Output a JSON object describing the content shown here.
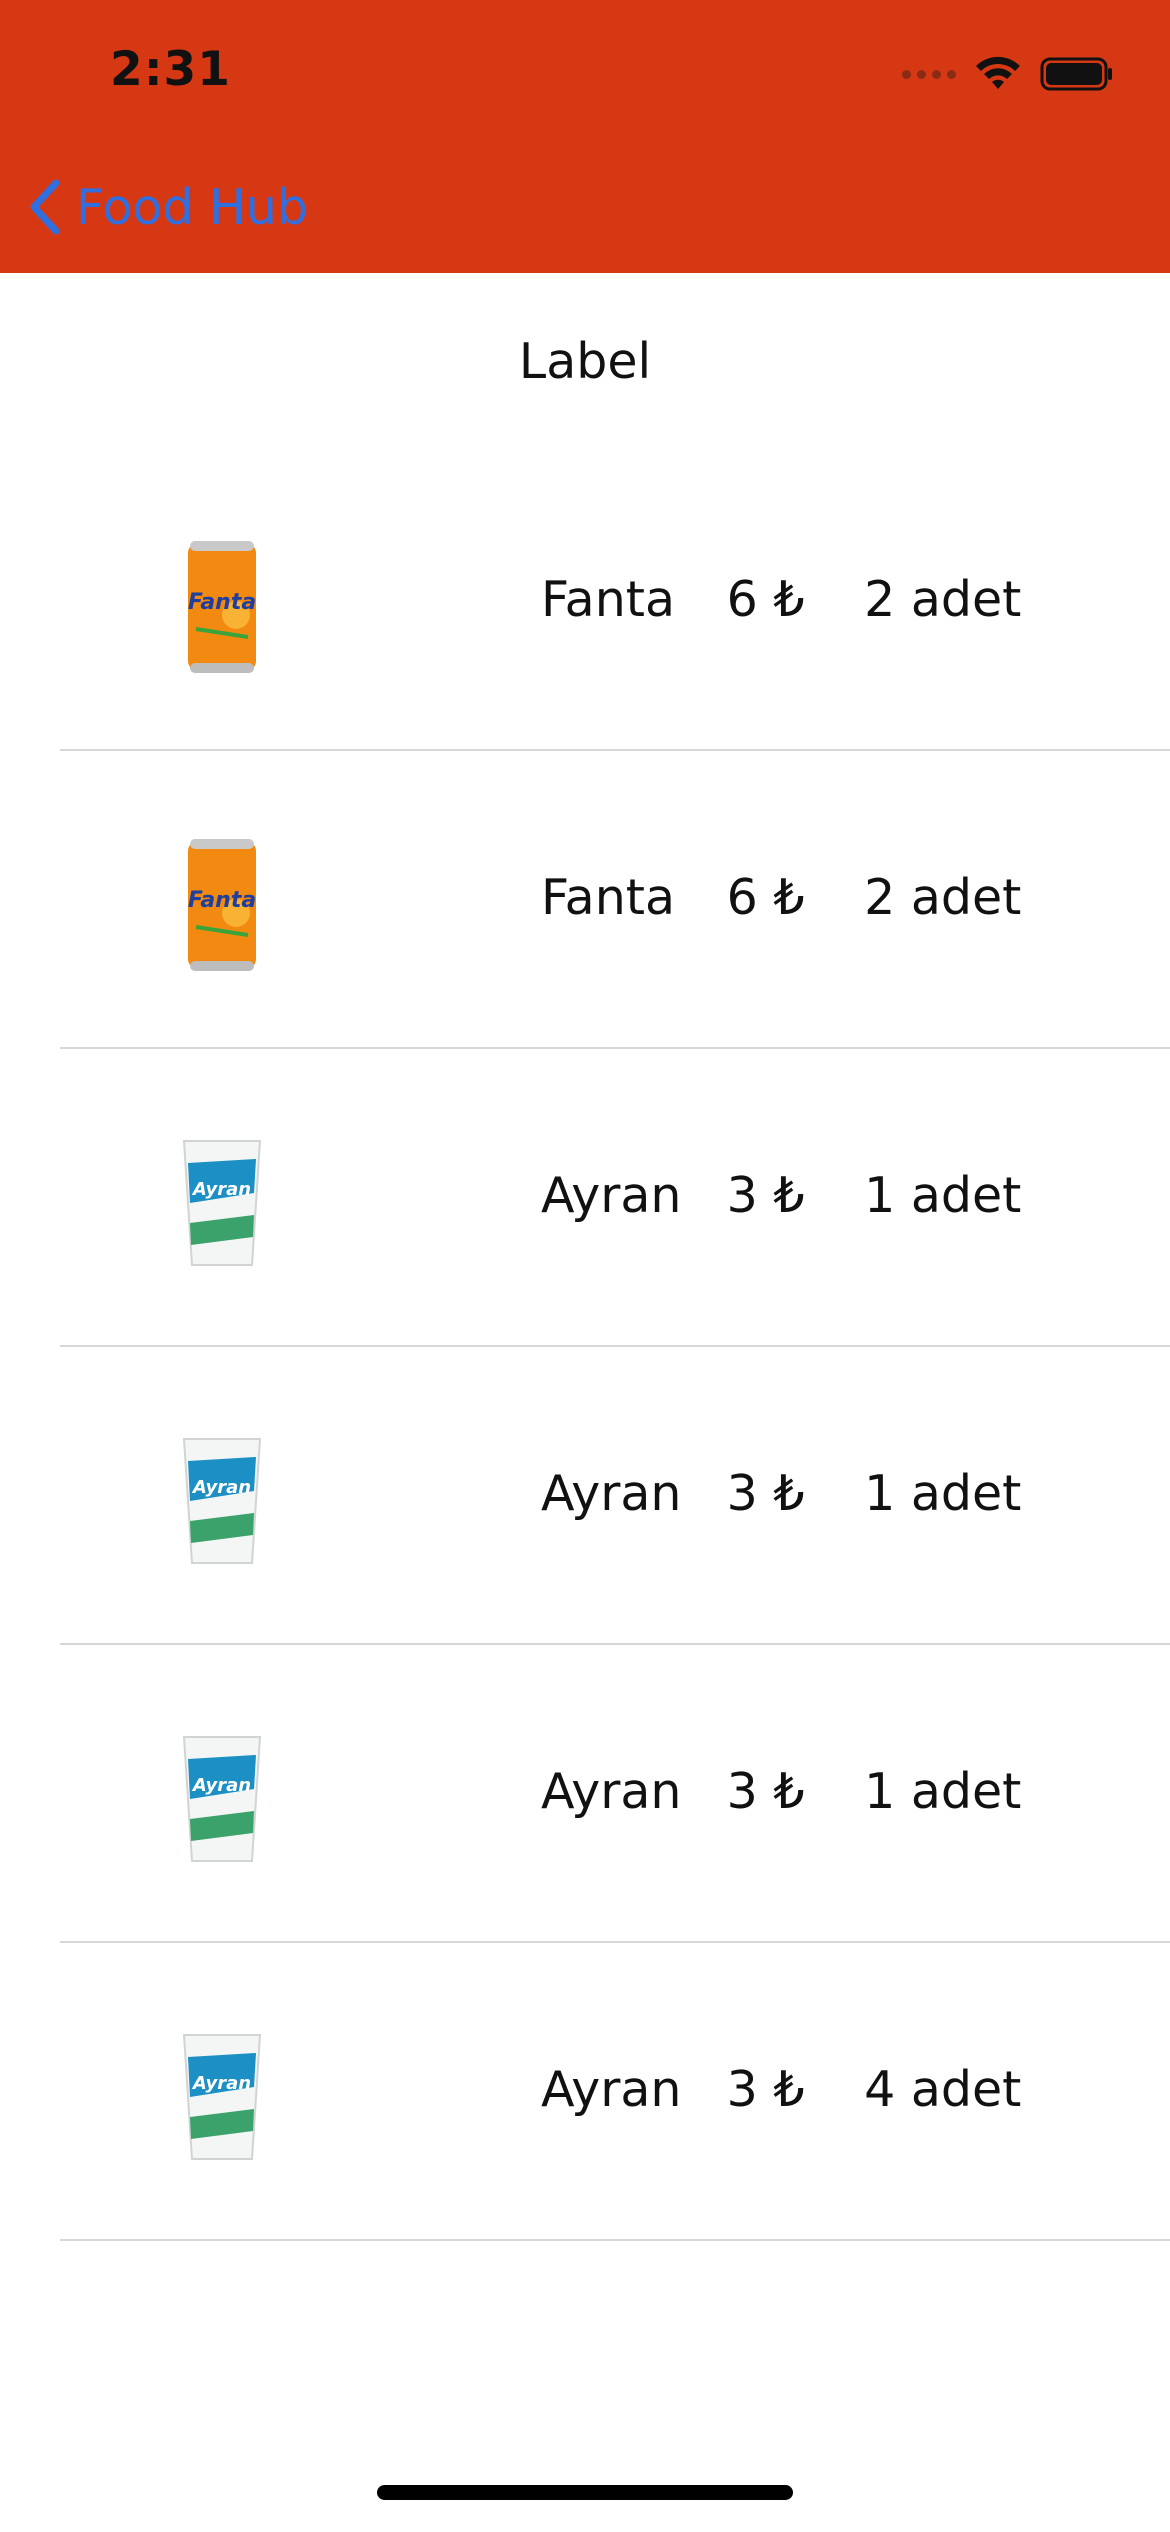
{
  "status_bar": {
    "time": "2:31"
  },
  "nav": {
    "back_label": "Food Hub"
  },
  "colors": {
    "header_bg": "#d73814",
    "back_tint": "#2f6fe0"
  },
  "page": {
    "label": "Label"
  },
  "items": [
    {
      "name": "Fanta",
      "price": "6 ₺",
      "quantity": "2 adet",
      "image_icon": "fanta-can-icon"
    },
    {
      "name": "Fanta",
      "price": "6 ₺",
      "quantity": "2 adet",
      "image_icon": "fanta-can-icon"
    },
    {
      "name": "Ayran",
      "price": "3 ₺",
      "quantity": "1 adet",
      "image_icon": "ayran-cup-icon"
    },
    {
      "name": "Ayran",
      "price": "3 ₺",
      "quantity": "1 adet",
      "image_icon": "ayran-cup-icon"
    },
    {
      "name": "Ayran",
      "price": "3 ₺",
      "quantity": "1 adet",
      "image_icon": "ayran-cup-icon"
    },
    {
      "name": "Ayran",
      "price": "3 ₺",
      "quantity": "4 adet",
      "image_icon": "ayran-cup-icon"
    }
  ]
}
